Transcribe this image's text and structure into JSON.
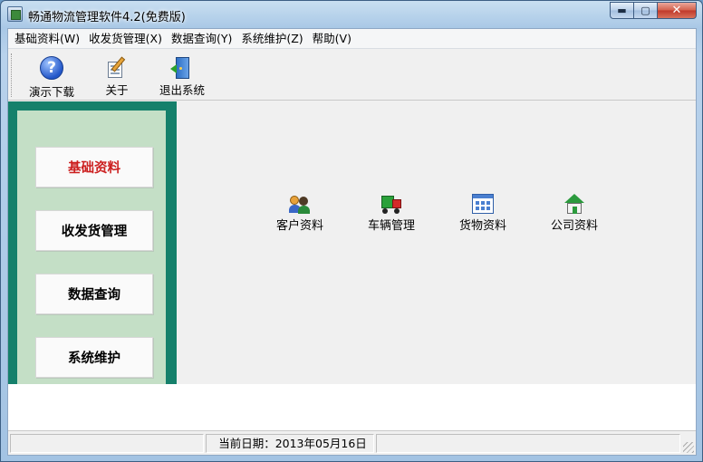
{
  "window": {
    "title": "畅通物流管理软件4.2(免费版)",
    "minimize_glyph": "▬",
    "maximize_glyph": "▢",
    "close_glyph": "✕"
  },
  "menu": {
    "items": [
      {
        "label": "基础资料(W)"
      },
      {
        "label": "收发货管理(X)"
      },
      {
        "label": "数据查询(Y)"
      },
      {
        "label": "系统维护(Z)"
      },
      {
        "label": "帮助(V)"
      }
    ]
  },
  "toolbar": {
    "items": [
      {
        "label": "演示下载",
        "icon": "help-icon"
      },
      {
        "label": "关于",
        "icon": "about-icon"
      },
      {
        "label": "退出系统",
        "icon": "exit-door-icon"
      }
    ]
  },
  "nav": {
    "items": [
      {
        "label": "基础资料",
        "active": true
      },
      {
        "label": "收发货管理",
        "active": false
      },
      {
        "label": "数据查询",
        "active": false
      },
      {
        "label": "系统维护",
        "active": false
      }
    ]
  },
  "modules": {
    "items": [
      {
        "label": "客户资料",
        "icon": "customers-icon"
      },
      {
        "label": "车辆管理",
        "icon": "truck-icon"
      },
      {
        "label": "货物资料",
        "icon": "goods-icon"
      },
      {
        "label": "公司资料",
        "icon": "company-icon"
      }
    ]
  },
  "status": {
    "date_text": "当前日期：2013年05月16日"
  },
  "colors": {
    "nav_panel": "#15806b",
    "nav_inner": "#c4dfc6",
    "active_nav_text": "#cc1f1f"
  }
}
